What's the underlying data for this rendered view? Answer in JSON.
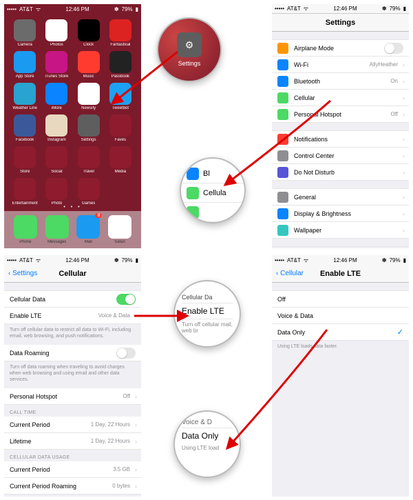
{
  "status": {
    "carrier": "AT&T",
    "time": "12:46 PM",
    "battery": "79%",
    "bt": "✽"
  },
  "home": {
    "rows": [
      [
        {
          "l": "Camera",
          "c": "#6b6b6b"
        },
        {
          "l": "Photos",
          "c": "#fff",
          "fg": "#e44"
        },
        {
          "l": "Clock",
          "c": "#000"
        },
        {
          "l": "Fantastical",
          "c": "#d22"
        }
      ],
      [
        {
          "l": "App Store",
          "c": "#1a9af1"
        },
        {
          "l": "iTunes Store",
          "c": "#c71585"
        },
        {
          "l": "Music",
          "c": "#ff3b30"
        },
        {
          "l": "Passbook",
          "c": "#222"
        }
      ],
      [
        {
          "l": "Weather Line",
          "c": "#29a3cf"
        },
        {
          "l": "iMore",
          "c": "#0a84ff"
        },
        {
          "l": "Newsify",
          "c": "#fff",
          "fg": "#555"
        },
        {
          "l": "Tweetbot",
          "c": "#1da1f2"
        }
      ],
      [
        {
          "l": "Facebook",
          "c": "#3b5998"
        },
        {
          "l": "Instagram",
          "c": "#e8d8c0"
        },
        {
          "l": "Settings",
          "c": "#5e5e5e"
        },
        {
          "l": "Faves",
          "c": "#8e1b2e"
        }
      ],
      [
        {
          "l": "Store",
          "c": "#8e1b2e"
        },
        {
          "l": "Social",
          "c": "#8e1b2e"
        },
        {
          "l": "Travel",
          "c": "#8e1b2e"
        },
        {
          "l": "Media",
          "c": "#8e1b2e"
        }
      ],
      [
        {
          "l": "Entertainment",
          "c": "#8e1b2e"
        },
        {
          "l": "Photo",
          "c": "#8e1b2e"
        },
        {
          "l": "Games",
          "c": "#8e1b2e"
        },
        {
          "l": "",
          "c": "transparent"
        }
      ]
    ],
    "dock": [
      {
        "l": "Phone",
        "c": "#4cd964"
      },
      {
        "l": "Messages",
        "c": "#4cd964"
      },
      {
        "l": "Mail",
        "c": "#1a9af1",
        "badge": "8"
      },
      {
        "l": "Safari",
        "c": "#fff"
      }
    ]
  },
  "zoom1": {
    "label": "Settings"
  },
  "zoom2": {
    "rows": [
      {
        "l": "Bl",
        "c": "#0a84ff"
      },
      {
        "l": "Cellula",
        "c": "#4cd964"
      },
      {
        "l": "",
        "c": "#4cd964"
      }
    ]
  },
  "zoom3": {
    "top": "Cellular Da",
    "mid": "Enable LTE",
    "bot": "Turn off cellular mail, web br"
  },
  "zoom4": {
    "top": "Voice & D",
    "mid": "Data Only",
    "bot": "Using LTE load"
  },
  "settings": {
    "title": "Settings",
    "g1": [
      {
        "l": "Airplane Mode",
        "c": "#ff9500",
        "toggle": false
      },
      {
        "l": "Wi-Fi",
        "c": "#0a84ff",
        "v": "AllyHeather"
      },
      {
        "l": "Bluetooth",
        "c": "#0a84ff",
        "v": "On"
      },
      {
        "l": "Cellular",
        "c": "#4cd964"
      },
      {
        "l": "Personal Hotspot",
        "c": "#4cd964",
        "v": "Off"
      }
    ],
    "g2": [
      {
        "l": "Notifications",
        "c": "#ff3b30"
      },
      {
        "l": "Control Center",
        "c": "#8e8e93"
      },
      {
        "l": "Do Not Disturb",
        "c": "#5856d6"
      }
    ],
    "g3": [
      {
        "l": "General",
        "c": "#8e8e93"
      },
      {
        "l": "Display & Brightness",
        "c": "#0a84ff"
      },
      {
        "l": "Wallpaper",
        "c": "#34c7c0"
      }
    ]
  },
  "cellular": {
    "back": "Settings",
    "title": "Cellular",
    "g1": [
      {
        "l": "Cellular Data",
        "toggle": true
      },
      {
        "l": "Enable LTE",
        "v": "Voice & Data"
      }
    ],
    "f1": "Turn off cellular data to restrict all data to Wi-Fi, including email, web browsing, and push notifications.",
    "g2": [
      {
        "l": "Data Roaming",
        "toggle": false
      }
    ],
    "f2": "Turn off data roaming when traveling to avoid charges when web browsing and using email and other data services.",
    "g3": [
      {
        "l": "Personal Hotspot",
        "v": "Off"
      }
    ],
    "s1": "CALL TIME",
    "g4": [
      {
        "l": "Current Period",
        "v": "1 Day, 22 Hours"
      },
      {
        "l": "Lifetime",
        "v": "1 Day, 22 Hours"
      }
    ],
    "s2": "CELLULAR DATA USAGE",
    "g5": [
      {
        "l": "Current Period",
        "v": "3.5 GB"
      },
      {
        "l": "Current Period Roaming",
        "v": "0 bytes"
      }
    ]
  },
  "lte": {
    "back": "Cellular",
    "title": "Enable LTE",
    "opts": [
      {
        "l": "Off"
      },
      {
        "l": "Voice & Data"
      },
      {
        "l": "Data Only",
        "sel": true
      }
    ],
    "foot": "Using LTE loads data faster."
  }
}
